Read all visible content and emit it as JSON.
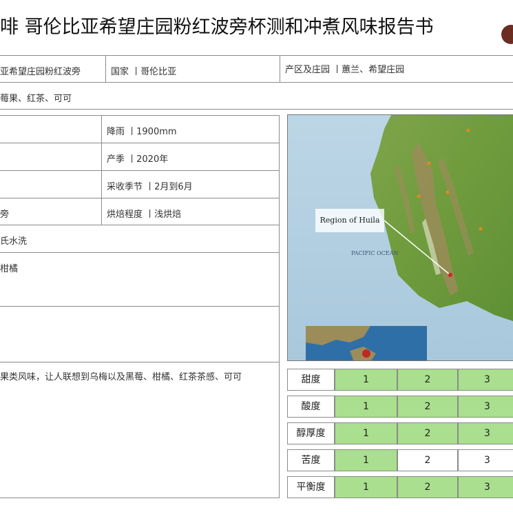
{
  "title": "啡  哥伦比亚希望庄园粉红波旁杯测和冲煮风味报告书",
  "info": {
    "name_frag": "亚希望庄园粉红波旁",
    "country": "国家  丨哥伦比亚",
    "region": "产区及庄园  丨蕙兰、希望庄园",
    "flavor_frag": "莓果、红茶、可可",
    "rainfall": "降雨  丨1900mm",
    "season": "产季  丨2020年",
    "harvest": "采收季节  丨2月到6月",
    "variety_frag": "旁",
    "roast": "烘焙程度  丨浅烘焙",
    "process_frag": "氏水洗",
    "aroma_frag": "柑橘",
    "desc_frag": "果类风味，让人联想到乌梅以及黑莓、柑橘、红茶茶感、可可"
  },
  "map": {
    "region_label": "Region of Huila",
    "ocean_label": "PACIFIC OCEAN"
  },
  "scores": [
    {
      "label": "甜度",
      "level": 3,
      "v1": "1",
      "v2": "2",
      "v3": "3"
    },
    {
      "label": "酸度",
      "level": 3,
      "v1": "1",
      "v2": "2",
      "v3": "3"
    },
    {
      "label": "醇厚度",
      "level": 3,
      "v1": "1",
      "v2": "2",
      "v3": "3"
    },
    {
      "label": "苦度",
      "level": 1,
      "v1": "1",
      "v2": "2",
      "v3": "3"
    },
    {
      "label": "平衡度",
      "level": 3,
      "v1": "1",
      "v2": "2",
      "v3": "3"
    }
  ],
  "colors": {
    "score_fill": "#a9df8e",
    "border": "#8a8a8a"
  }
}
